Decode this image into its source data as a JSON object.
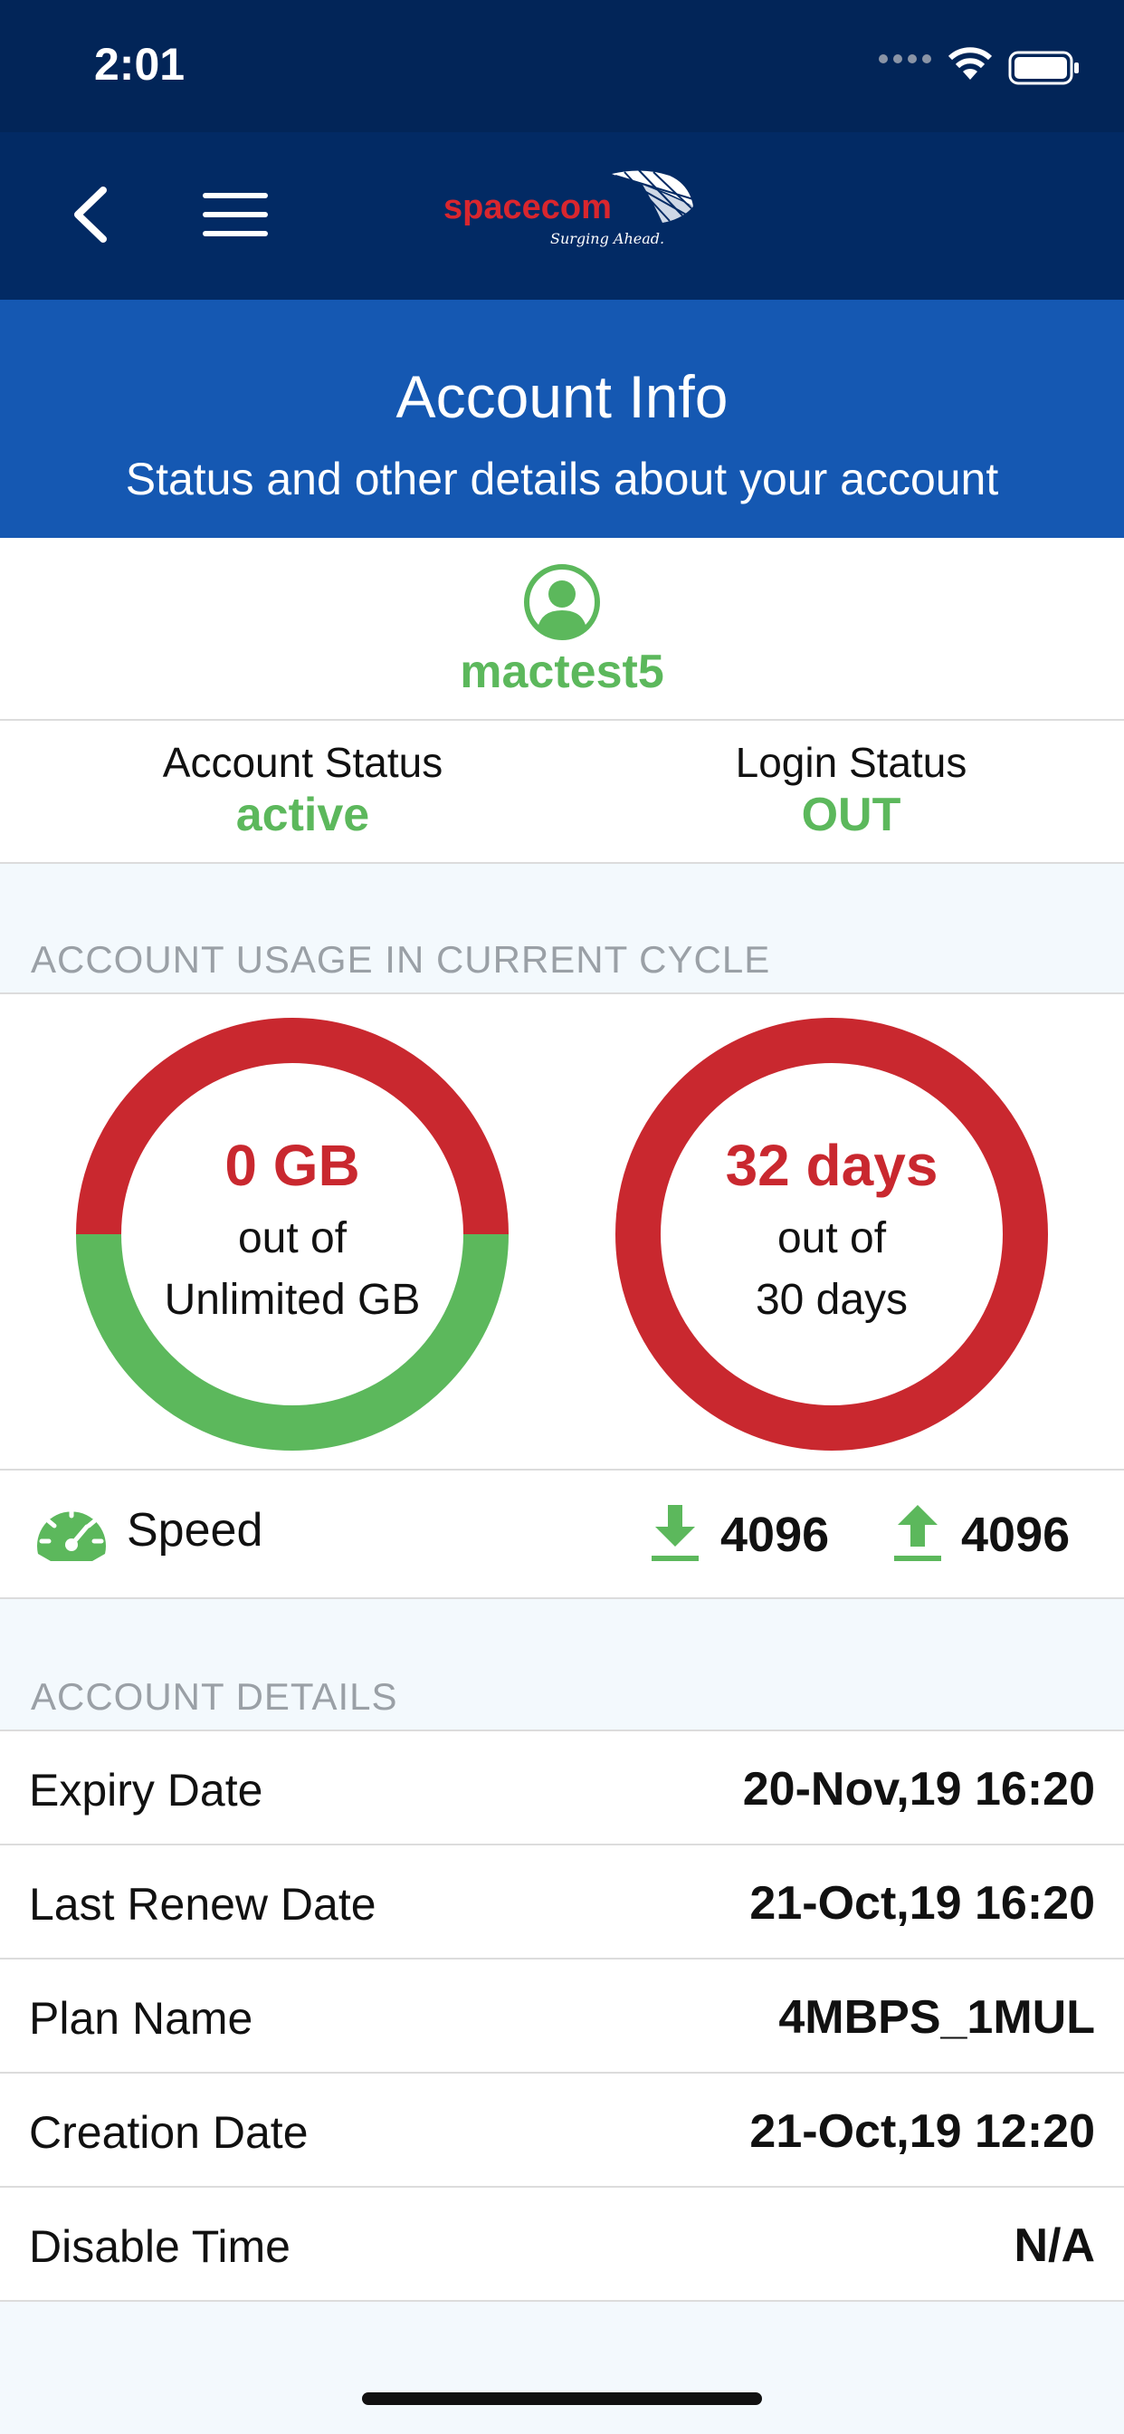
{
  "status_bar": {
    "time": "2:01"
  },
  "navbar": {
    "logo_text": "spacecom",
    "logo_tagline": "Surging Ahead."
  },
  "header": {
    "title": "Account Info",
    "subtitle": "Status and other details about your account"
  },
  "user": {
    "username": "mactest5"
  },
  "status": {
    "account_label": "Account Status",
    "account_value": "active",
    "login_label": "Login Status",
    "login_value": "OUT"
  },
  "usage": {
    "section_title": "ACCOUNT USAGE IN CURRENT CYCLE",
    "data": {
      "value": "0 GB",
      "line2": "out of",
      "line3": "Unlimited GB",
      "used_fraction": 0.5
    },
    "time": {
      "value": "32 days",
      "line2": "out of",
      "line3": "30 days",
      "used_fraction": 1.0
    }
  },
  "speed": {
    "label": "Speed",
    "download": "4096",
    "upload": "4096"
  },
  "details": {
    "section_title": "ACCOUNT DETAILS",
    "rows": [
      {
        "label": "Expiry Date",
        "value": "20-Nov,19 16:20"
      },
      {
        "label": "Last Renew Date",
        "value": "21-Oct,19 16:20"
      },
      {
        "label": "Plan Name",
        "value": "4MBPS_1MUL"
      },
      {
        "label": "Creation Date",
        "value": "21-Oct,19 12:20"
      },
      {
        "label": "Disable Time",
        "value": "N/A"
      }
    ]
  },
  "colors": {
    "green": "#5cb85c",
    "red": "#c9282f",
    "navy": "#022a64",
    "blue": "#1558b2"
  }
}
